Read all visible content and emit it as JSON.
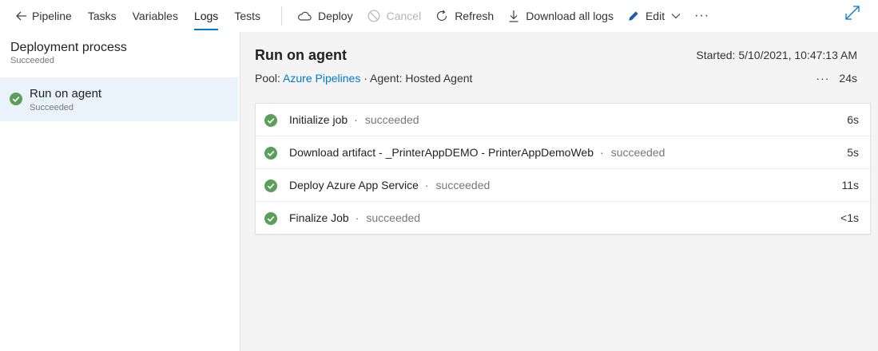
{
  "toolbar": {
    "back_label": "Pipeline",
    "tabs": [
      {
        "label": "Tasks"
      },
      {
        "label": "Variables"
      },
      {
        "label": "Logs"
      },
      {
        "label": "Tests"
      }
    ],
    "actions": {
      "deploy": "Deploy",
      "cancel": "Cancel",
      "refresh": "Refresh",
      "download": "Download all logs",
      "edit": "Edit"
    },
    "more": "···",
    "active_tab": "Logs"
  },
  "left_panel": {
    "process_title": "Deployment process",
    "process_status": "Succeeded",
    "job_name": "Run on agent",
    "job_status": "Succeeded"
  },
  "right_panel": {
    "title": "Run on agent",
    "started": "Started: 5/10/2021, 10:47:13 AM",
    "pool_label": "Pool:",
    "pool_value": "Azure Pipelines",
    "agent_text": "· Agent: Hosted Agent",
    "more": "···",
    "total_duration": "24s",
    "steps": [
      {
        "name": "Initialize job",
        "status": "succeeded",
        "duration": "6s"
      },
      {
        "name": "Download artifact - _PrinterAppDEMO - PrinterAppDemoWeb",
        "status": "succeeded",
        "duration": "5s"
      },
      {
        "name": "Deploy Azure App Service",
        "status": "succeeded",
        "duration": "11s"
      },
      {
        "name": "Finalize Job",
        "status": "succeeded",
        "duration": "<1s"
      }
    ]
  },
  "colors": {
    "accent": "#0078d4",
    "success": "#5aa05a",
    "selected_bg": "#eaf3fb"
  }
}
